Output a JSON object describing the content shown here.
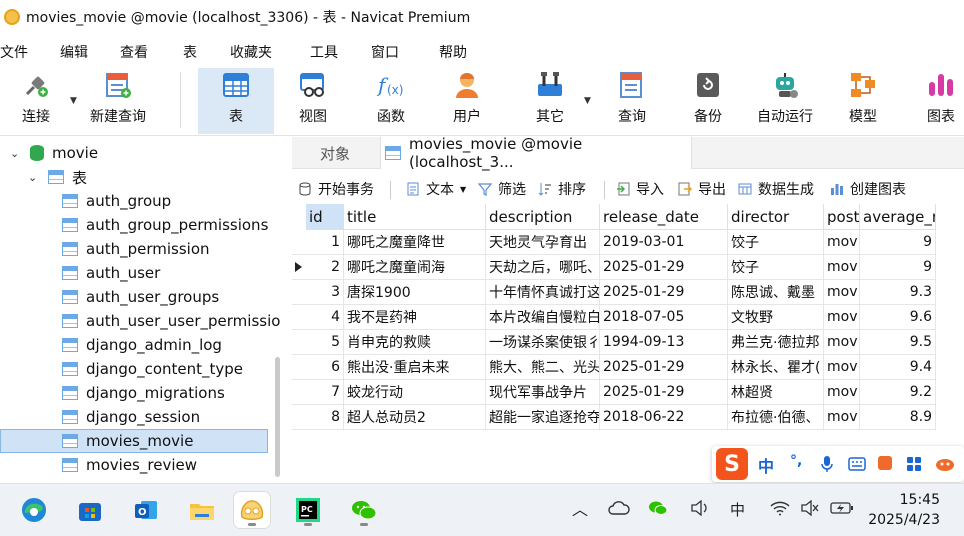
{
  "window": {
    "title": "movies_movie @movie (localhost_3306) - 表 - Navicat Premium"
  },
  "menu": [
    "文件",
    "编辑",
    "查看",
    "表",
    "收藏夹",
    "工具",
    "窗口",
    "帮助"
  ],
  "toolbar": {
    "connect": "连接",
    "new_query": "新建查询",
    "table": "表",
    "view": "视图",
    "function": "函数",
    "user": "用户",
    "other": "其它",
    "query": "查询",
    "backup": "备份",
    "automation": "自动运行",
    "model": "模型",
    "chart": "图表"
  },
  "sidebar": {
    "database": "movie",
    "tables_group": "表",
    "tables": [
      "auth_group",
      "auth_group_permissions",
      "auth_permission",
      "auth_user",
      "auth_user_groups",
      "auth_user_user_permissio",
      "django_admin_log",
      "django_content_type",
      "django_migrations",
      "django_session",
      "movies_movie",
      "movies_review"
    ],
    "selected": "movies_movie"
  },
  "tabs": {
    "objects": "对象",
    "active": "movies_movie @movie (localhost_3..."
  },
  "subtoolbar": {
    "begin_tx": "开始事务",
    "text": "文本",
    "filter": "筛选",
    "sort": "排序",
    "import": "导入",
    "export": "导出",
    "data_gen": "数据生成",
    "create_chart": "创建图表"
  },
  "grid": {
    "columns": [
      "id",
      "title",
      "description",
      "release_date",
      "director",
      "post",
      "average_ra"
    ],
    "rows": [
      [
        "1",
        "哪吒之魔童降世",
        "天地灵气孕育出",
        "2019-03-01",
        "饺子",
        "mov",
        "9"
      ],
      [
        "2",
        "哪吒之魔童闹海",
        "天劫之后，哪吒、",
        "2025-01-29",
        "饺子",
        "mov",
        "9"
      ],
      [
        "3",
        "唐探1900",
        "十年情怀真诚打这",
        "2025-01-29",
        "陈思诚、戴墨",
        "mov",
        "9.3"
      ],
      [
        "4",
        "我不是药神",
        "本片改编自慢粒白",
        "2018-07-05",
        "文牧野",
        "mov",
        "9.6"
      ],
      [
        "5",
        "肖申克的救赎",
        "一场谋杀案使银彳",
        "1994-09-13",
        "弗兰克·德拉邦",
        "mov",
        "9.5"
      ],
      [
        "6",
        "熊出没·重启未来",
        "熊大、熊二、光头",
        "2025-01-29",
        "林永长、瞿才(",
        "mov",
        "9.4"
      ],
      [
        "7",
        "蛟龙行动",
        "现代军事战争片",
        "2025-01-29",
        "林超贤",
        "mov",
        "9.2"
      ],
      [
        "8",
        "超人总动员2",
        "超能一家追逐抢夺",
        "2018-06-22",
        "布拉德·伯德、",
        "mov",
        "8.9"
      ]
    ]
  },
  "ime": {
    "s": "S",
    "zh": "中",
    "punct": "°,"
  },
  "taskbar": {
    "time": "15:45",
    "date": "2025/4/23",
    "ime_tray": "中"
  }
}
